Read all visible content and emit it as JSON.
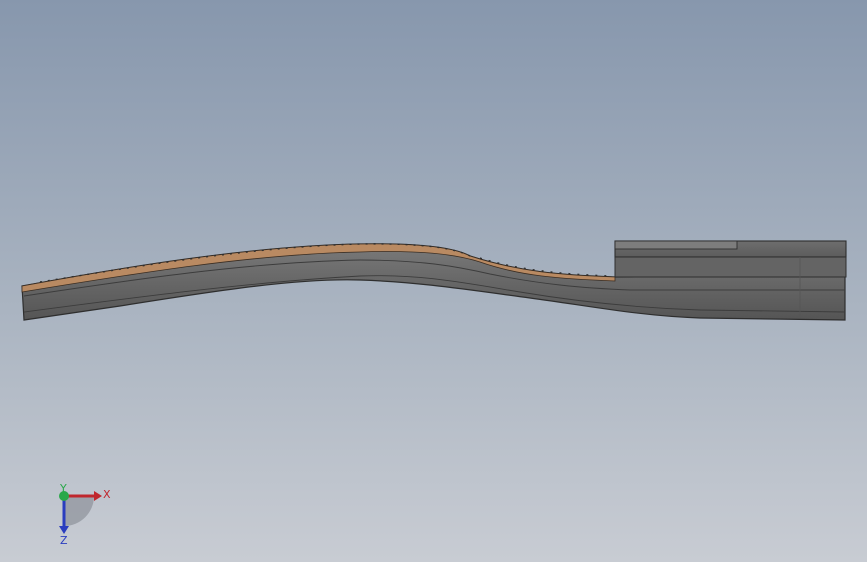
{
  "viewport": {
    "background_top": "#8797ad",
    "background_bottom": "#c8ccd3"
  },
  "model": {
    "body_color": "#6b6b6b",
    "body_dark": "#4f4f4f",
    "body_light": "#8a8a8a",
    "top_surface_color": "#b98a62",
    "edge_color": "#2e2e2e"
  },
  "triad": {
    "x_label": "X",
    "y_label": "Y",
    "z_label": "Z",
    "x_color": "#c0272d",
    "y_color": "#2aa84a",
    "z_color": "#2a3dbf"
  }
}
